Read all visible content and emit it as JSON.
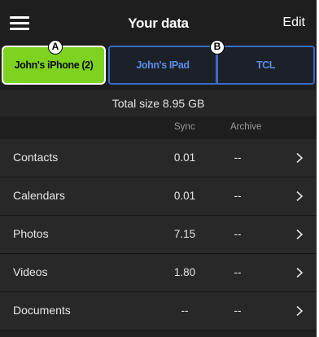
{
  "header": {
    "title": "Your data",
    "edit_label": "Edit",
    "menu_icon": "hamburger-menu-icon"
  },
  "devices": {
    "tabs": [
      {
        "label": "John's iPhone (2)",
        "active": true,
        "marker": "A"
      },
      {
        "label": "John's IPad",
        "active": false,
        "marker": "B"
      },
      {
        "label": "TCL",
        "active": false
      }
    ],
    "active_color": "#7ed321",
    "inactive_border_color": "#3b69c8",
    "inactive_text_color": "#5a8ee8"
  },
  "summary": {
    "total_size": "Total size 8.95 GB"
  },
  "columns": {
    "sync": "Sync",
    "archive": "Archive"
  },
  "rows": [
    {
      "label": "Contacts",
      "sync": "0.01",
      "archive": "--",
      "icon": "chevron-right-icon"
    },
    {
      "label": "Calendars",
      "sync": "0.01",
      "archive": "--",
      "icon": "chevron-right-icon"
    },
    {
      "label": "Photos",
      "sync": "7.15",
      "archive": "--",
      "icon": "chevron-right-icon"
    },
    {
      "label": "Videos",
      "sync": "1.80",
      "archive": "--",
      "icon": "chevron-right-icon"
    },
    {
      "label": "Documents",
      "sync": "--",
      "archive": "--",
      "icon": "chevron-right-icon"
    }
  ]
}
